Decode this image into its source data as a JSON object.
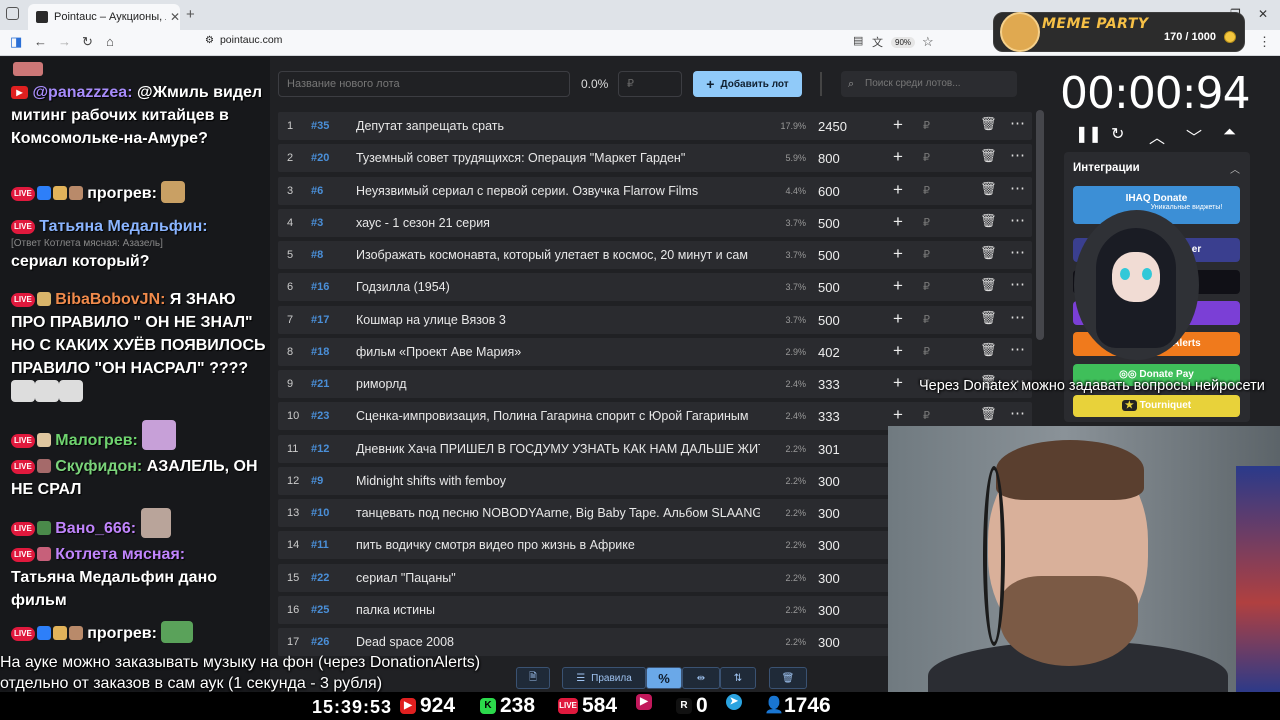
{
  "browser": {
    "tab_title": "Pointauc – Аукционы, лотереи",
    "url": "pointauc.com",
    "zoom": "90%"
  },
  "widget": {
    "title": "MEME PARTY",
    "progress": "170 / 1000"
  },
  "chat": [
    {
      "nick": "@panazzzea:",
      "nick_color": "#a78bfa",
      "text": " @Жмиль видел митинг рабочих китайцев в Комсомольке-на-Амуре?"
    },
    {
      "nick": "прогрев:",
      "nick_color": "#ffffff",
      "text": ""
    },
    {
      "nick": "Татьяна Медальфин:",
      "nick_color": "#8ab4ff",
      "reply": "[Ответ Котлета мясная: Азазель]",
      "text": "сериал который?"
    },
    {
      "nick": "BibaBobovJN:",
      "nick_color": "#f08a4b",
      "text": " Я ЗНАЮ ПРО ПРАВИЛО \" ОН НЕ ЗНАЛ\" НО С КАКИХ ХУЁВ ПОЯВИЛОСЬ ПРАВИЛО \"ОН НАСРАЛ\" ????"
    },
    {
      "nick": "Малогрев:",
      "nick_color": "#6fd36f",
      "text": ""
    },
    {
      "nick": "Скуфидон:",
      "nick_color": "#7ad37a",
      "text": " АЗАЛЕЛЬ, ОН НЕ СРАЛ"
    },
    {
      "nick": "Вано_666:",
      "nick_color": "#c084fc",
      "text": ""
    },
    {
      "nick": "Котлета мясная:",
      "nick_color": "#c084fc",
      "text": "Татьяна Медальфин дано фильм"
    },
    {
      "nick": "прогрев:",
      "nick_color": "#ffffff",
      "text": ""
    }
  ],
  "toolbar": {
    "lot_placeholder": "Название нового лота",
    "percent": "0.0%",
    "rub_placeholder": "₽",
    "add_label": "Добавить лот",
    "search_placeholder": "Поиск среди лотов..."
  },
  "lots": [
    {
      "idx": "1",
      "id": "#35",
      "name": "Депутат запрещать срать",
      "pct": "17.9%",
      "amount": "2450"
    },
    {
      "idx": "2",
      "id": "#20",
      "name": "Туземный совет трудящихся: Операция \"Маркет Гарден\"",
      "pct": "5.9%",
      "amount": "800"
    },
    {
      "idx": "3",
      "id": "#6",
      "name": "Неуязвимый сериал с первой серии. Озвучка Flarrow Films",
      "pct": "4.4%",
      "amount": "600"
    },
    {
      "idx": "4",
      "id": "#3",
      "name": "хаус - 1 сезон 21 серия",
      "pct": "3.7%",
      "amount": "500"
    },
    {
      "idx": "5",
      "id": "#8",
      "name": "Изображать космонавта, который улетает в космос, 20 минут и сам",
      "pct": "3.7%",
      "amount": "500"
    },
    {
      "idx": "6",
      "id": "#16",
      "name": "Годзилла (1954)",
      "pct": "3.7%",
      "amount": "500"
    },
    {
      "idx": "7",
      "id": "#17",
      "name": "Кошмар на улице Вязов 3",
      "pct": "3.7%",
      "amount": "500"
    },
    {
      "idx": "8",
      "id": "#18",
      "name": "фильм «Проект Аве Мария»",
      "pct": "2.9%",
      "amount": "402"
    },
    {
      "idx": "9",
      "id": "#21",
      "name": "риморлд",
      "pct": "2.4%",
      "amount": "333"
    },
    {
      "idx": "10",
      "id": "#23",
      "name": "Сценка-импровизация, Полина Гагарина спорит с Юрой Гагариным",
      "pct": "2.4%",
      "amount": "333"
    },
    {
      "idx": "11",
      "id": "#12",
      "name": "Дневник Хача ПРИШЕЛ В ГОСДУМУ УЗНАТЬ КАК НАМ ДАЛЬШЕ ЖИТЬ",
      "pct": "2.2%",
      "amount": "301"
    },
    {
      "idx": "12",
      "id": "#9",
      "name": "Midnight shifts with femboy",
      "pct": "2.2%",
      "amount": "300"
    },
    {
      "idx": "13",
      "id": "#10",
      "name": "танцевать под песню NOBODYAarne, Big Baby Tape. Альбом SLAANG",
      "pct": "2.2%",
      "amount": "300"
    },
    {
      "idx": "14",
      "id": "#11",
      "name": "пить водичку смотря видео про жизнь в Африке",
      "pct": "2.2%",
      "amount": "300"
    },
    {
      "idx": "15",
      "id": "#22",
      "name": "сериал \"Пацаны\"",
      "pct": "2.2%",
      "amount": "300"
    },
    {
      "idx": "16",
      "id": "#25",
      "name": "палка истины",
      "pct": "2.2%",
      "amount": "300"
    },
    {
      "idx": "17",
      "id": "#26",
      "name": "Dead space 2008",
      "pct": "2.2%",
      "amount": "300"
    }
  ],
  "timer": "00:00:94",
  "integrations": {
    "title": "Интеграции",
    "buttons": [
      {
        "label": "IHAQ Donate",
        "sub": "Уникальные виджеты!",
        "color": "#3c8fd6"
      },
      {
        "label": "er",
        "sub": "",
        "color": "#3a3f8f"
      },
      {
        "label": "",
        "sub": "",
        "color": "#101016"
      },
      {
        "label": "",
        "sub": "",
        "color": "#7b3fd6"
      },
      {
        "label": "Alerts",
        "sub": "",
        "color": "#f07a1c"
      },
      {
        "label": "Donate Pay",
        "sub": "",
        "color": "#3fbf5a"
      },
      {
        "label": "Tourniquet",
        "sub": "",
        "color": "#e8d23a"
      }
    ]
  },
  "captions": {
    "right": "Через Donatex можно задавать вопросы нейросети",
    "bottom_1": "На ауке можно заказывать музыку на фон (через DonationAlerts)",
    "bottom_2": "отдельно от заказов в сам аук (1 секунда - 3 рубля)"
  },
  "bottom_toolbar": {
    "rules_label": "Правила"
  },
  "stats": {
    "clock": "15:39:53",
    "youtube": "924",
    "kick": "238",
    "vk": "584",
    "rutube": "0",
    "viewers": "1746"
  }
}
